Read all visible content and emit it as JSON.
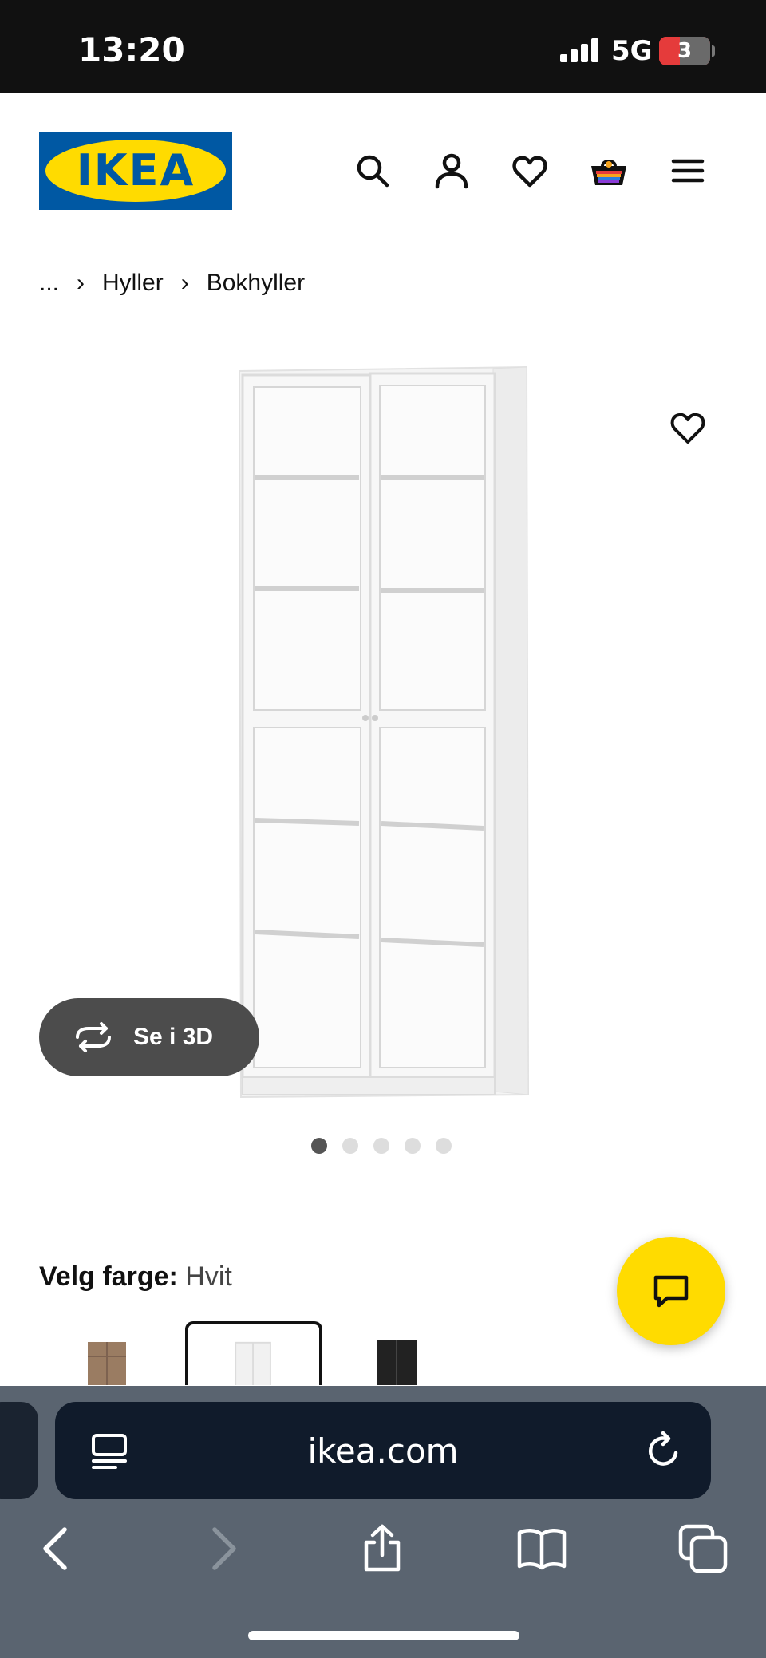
{
  "status_bar": {
    "time": "13:20",
    "network": "5G",
    "battery": "3"
  },
  "header": {
    "logo_text": "IKEA",
    "icons": [
      "search-icon",
      "account-icon",
      "heart-icon",
      "cart-icon",
      "menu-icon"
    ]
  },
  "breadcrumb": {
    "items": [
      "...",
      "Hyller",
      "Bokhyller"
    ]
  },
  "gallery": {
    "view_3d_label": "Se i 3D",
    "image_count": 5,
    "active_index": 0
  },
  "color_select": {
    "label": "Velg farge:",
    "value": "Hvit",
    "swatches": [
      "brown",
      "white",
      "black"
    ],
    "selected_swatch": 1
  },
  "chat": {
    "icon": "chat-icon"
  },
  "browser": {
    "url": "ikea.com"
  },
  "colors": {
    "ikea_blue": "#0058a3",
    "ikea_yellow": "#ffdb00"
  }
}
